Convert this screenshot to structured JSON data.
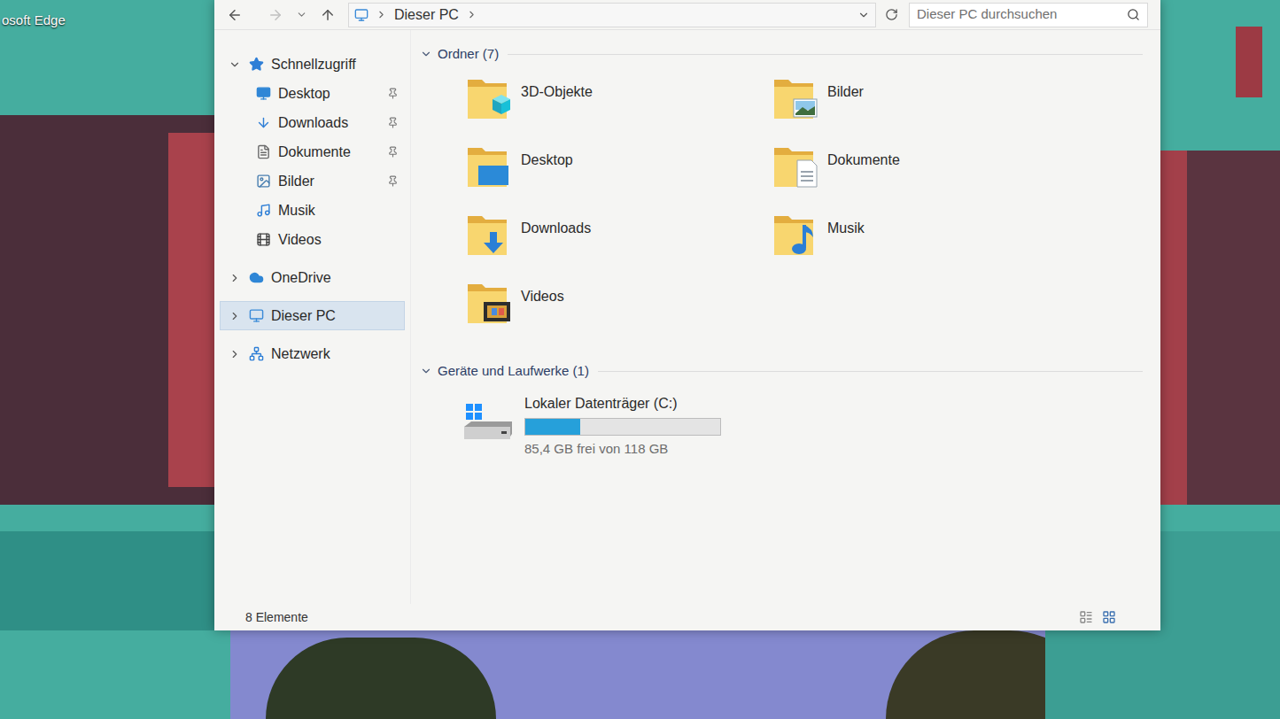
{
  "desktop": {
    "shortcut_label": "osoft Edge"
  },
  "window": {
    "address": {
      "path": [
        "Dieser PC"
      ]
    },
    "search": {
      "placeholder": "Dieser PC durchsuchen"
    },
    "nav": [
      {
        "label": "Schnellzugriff",
        "kind": "group",
        "expanded": true,
        "selected": false
      },
      {
        "label": "Desktop",
        "kind": "item",
        "pinned": true,
        "selected": false
      },
      {
        "label": "Downloads",
        "kind": "item",
        "pinned": true,
        "selected": false
      },
      {
        "label": "Dokumente",
        "kind": "item",
        "pinned": true,
        "selected": false
      },
      {
        "label": "Bilder",
        "kind": "item",
        "pinned": true,
        "selected": false
      },
      {
        "label": "Musik",
        "kind": "item",
        "pinned": false,
        "selected": false
      },
      {
        "label": "Videos",
        "kind": "item",
        "pinned": false,
        "selected": false
      },
      {
        "label": "OneDrive",
        "kind": "group",
        "expanded": false,
        "selected": false
      },
      {
        "label": "Dieser PC",
        "kind": "group",
        "expanded": false,
        "selected": true
      },
      {
        "label": "Netzwerk",
        "kind": "group",
        "expanded": false,
        "selected": false
      }
    ],
    "sections": {
      "folders": {
        "title": "Ordner (7)",
        "expanded": true,
        "items": [
          {
            "label": "3D-Objekte",
            "selected": false
          },
          {
            "label": "Bilder",
            "selected": false
          },
          {
            "label": "Desktop",
            "selected": false
          },
          {
            "label": "Dokumente",
            "selected": false
          },
          {
            "label": "Downloads",
            "selected": false
          },
          {
            "label": "Musik",
            "selected": false
          },
          {
            "label": "Videos",
            "selected": false
          }
        ]
      },
      "drives": {
        "title": "Geräte und Laufwerke (1)",
        "expanded": true,
        "items": [
          {
            "label": "Lokaler Datenträger (C:)",
            "level": 0.28,
            "reading": "85,4 GB frei von 118 GB",
            "selected": false
          }
        ]
      }
    },
    "status_bar": {
      "count": "8 Elemente"
    }
  }
}
